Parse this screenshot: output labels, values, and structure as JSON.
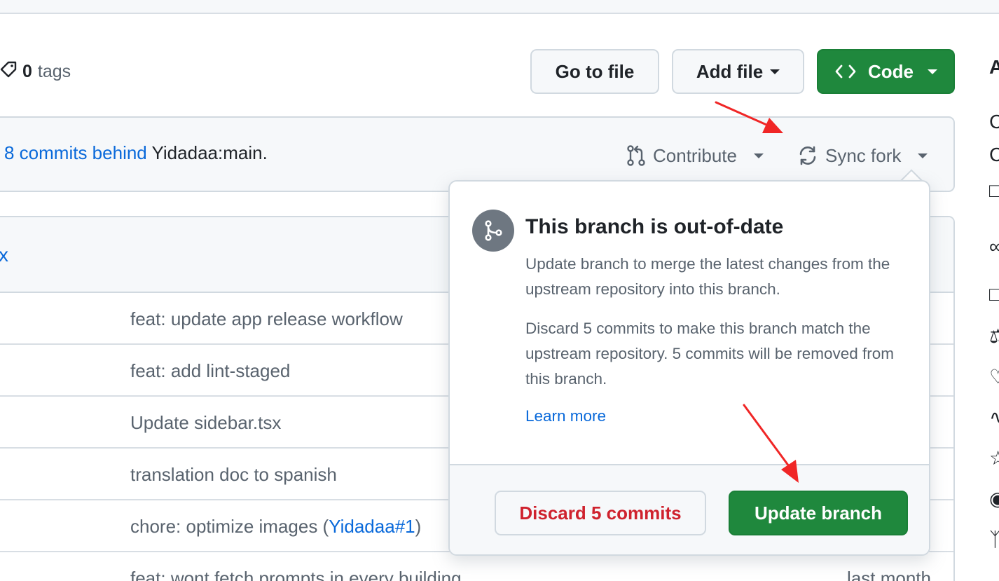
{
  "repo": {
    "tag_count": "0",
    "tag_word": "tags"
  },
  "toolbar": {
    "go_to_file": "Go to file",
    "add_file": "Add file",
    "code": "Code"
  },
  "fork_banner": {
    "behind_link": "8 commits behind",
    "upstream": "Yidadaa:main.",
    "contribute": "Contribute",
    "sync_fork": "Sync fork"
  },
  "commit_list": {
    "header_fragment": "x",
    "rows": [
      {
        "message": "feat: update app release workflow",
        "date": ""
      },
      {
        "message": "feat: add lint-staged",
        "date": ""
      },
      {
        "message": "Update sidebar.tsx",
        "date": ""
      },
      {
        "message": "translation doc to spanish",
        "date": ""
      },
      {
        "message_prefix": "chore: optimize images (",
        "ref": "Yidadaa#1",
        "message_suffix": ")",
        "date": ""
      },
      {
        "message": "feat: wont fetch prompts in every building",
        "date": "last month"
      }
    ]
  },
  "sync_popover": {
    "title": "This branch is out-of-date",
    "paragraph_1": "Update branch to merge the latest changes from the upstream repository into this branch.",
    "paragraph_2": "Discard 5 commits to make this branch match the upstream repository. 5 commits will be removed from this branch.",
    "learn_more": "Learn more",
    "discard_button": "Discard 5 commits",
    "update_button": "Update branch"
  },
  "sidebar_fragments": [
    "A",
    "C",
    "C"
  ],
  "colors": {
    "accent_green": "#1f883d",
    "link_blue": "#0969da",
    "danger_red": "#cf222e",
    "annotation_red": "#f02626"
  }
}
